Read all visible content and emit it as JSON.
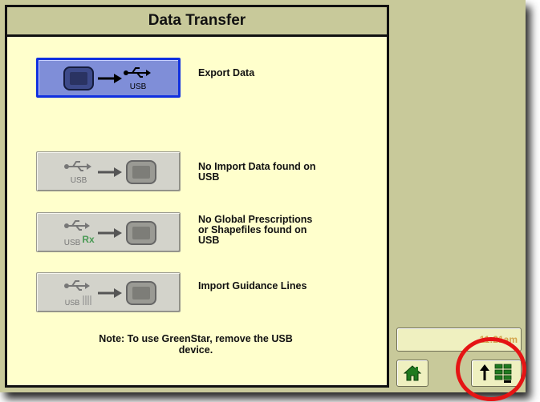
{
  "panel": {
    "title": "Data Transfer",
    "rows": [
      {
        "label_lines": [
          "Export Data"
        ],
        "state": "active",
        "icon": "export-display-to-usb-icon"
      },
      {
        "label_lines": [
          "No Import Data found on",
          "USB"
        ],
        "state": "disabled",
        "icon": "import-usb-to-display-icon"
      },
      {
        "label_lines": [
          "No Global Prescriptions",
          "or Shapefiles found on",
          "USB"
        ],
        "state": "disabled",
        "icon": "import-prescription-usb-icon"
      },
      {
        "label_lines": [
          "Import Guidance Lines"
        ],
        "state": "disabled",
        "icon": "import-guidance-usb-icon"
      }
    ],
    "note_lines": [
      "Note: To use GreenStar, remove the USB",
      "device."
    ],
    "usb_text": "USB",
    "rx_text": "Rx"
  },
  "side": {
    "clock": "11:21am",
    "home_icon": "home-icon",
    "menu_icon": "menu-up-icon"
  },
  "colors": {
    "panel_bg": "#ffffcc",
    "frame_bg": "#c8c99a",
    "active_button": "#7f8ed8",
    "active_border": "#1030e0",
    "home_icon_color": "#1f7a1f",
    "highlight_circle": "#e51414"
  }
}
